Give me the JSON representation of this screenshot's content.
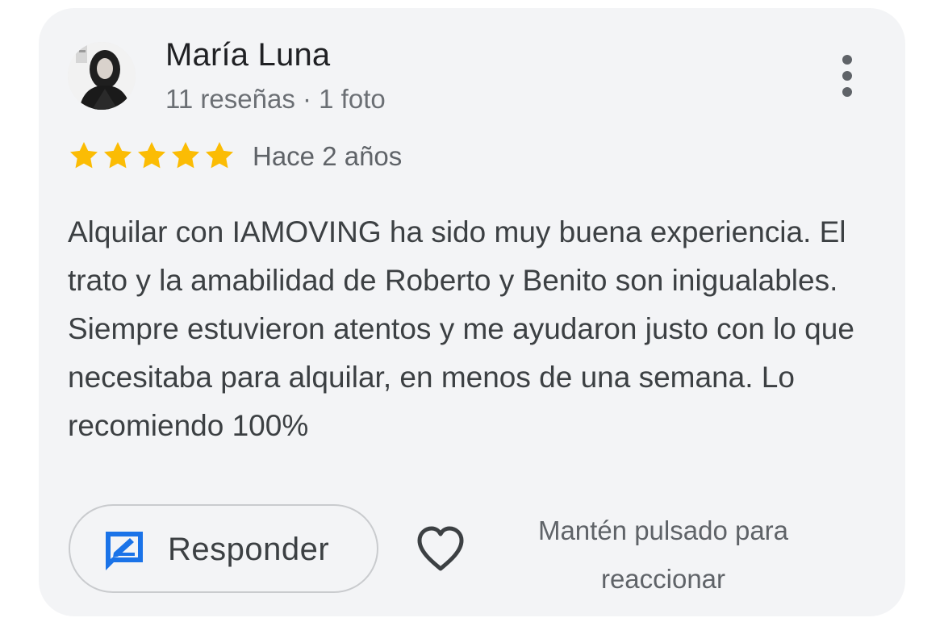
{
  "review": {
    "author": "María Luna",
    "meta": "11 reseñas · 1 foto",
    "rating": 5,
    "rating_max": 5,
    "date": "Hace 2 años",
    "text": "Alquilar con IAMOVING ha sido muy buena experiencia. El trato y la amabilidad de Roberto y Benito son inigualables. Siempre estuvieron atentos y me ayudaron justo con lo que necesitaba para alquilar, en menos de una semana. Lo recomiendo 100%"
  },
  "actions": {
    "reply_label": "Responder",
    "reply_icon": "reply-edit-icon",
    "like_icon": "heart-outline-icon",
    "hint": "Mantén pulsado para reaccionar",
    "more_icon": "more-vertical-icon"
  },
  "colors": {
    "card_bg": "#f3f4f6",
    "star": "#fbbc04",
    "accent_blue": "#1a73e8",
    "text_primary": "#202124",
    "text_secondary": "#5f6368"
  }
}
